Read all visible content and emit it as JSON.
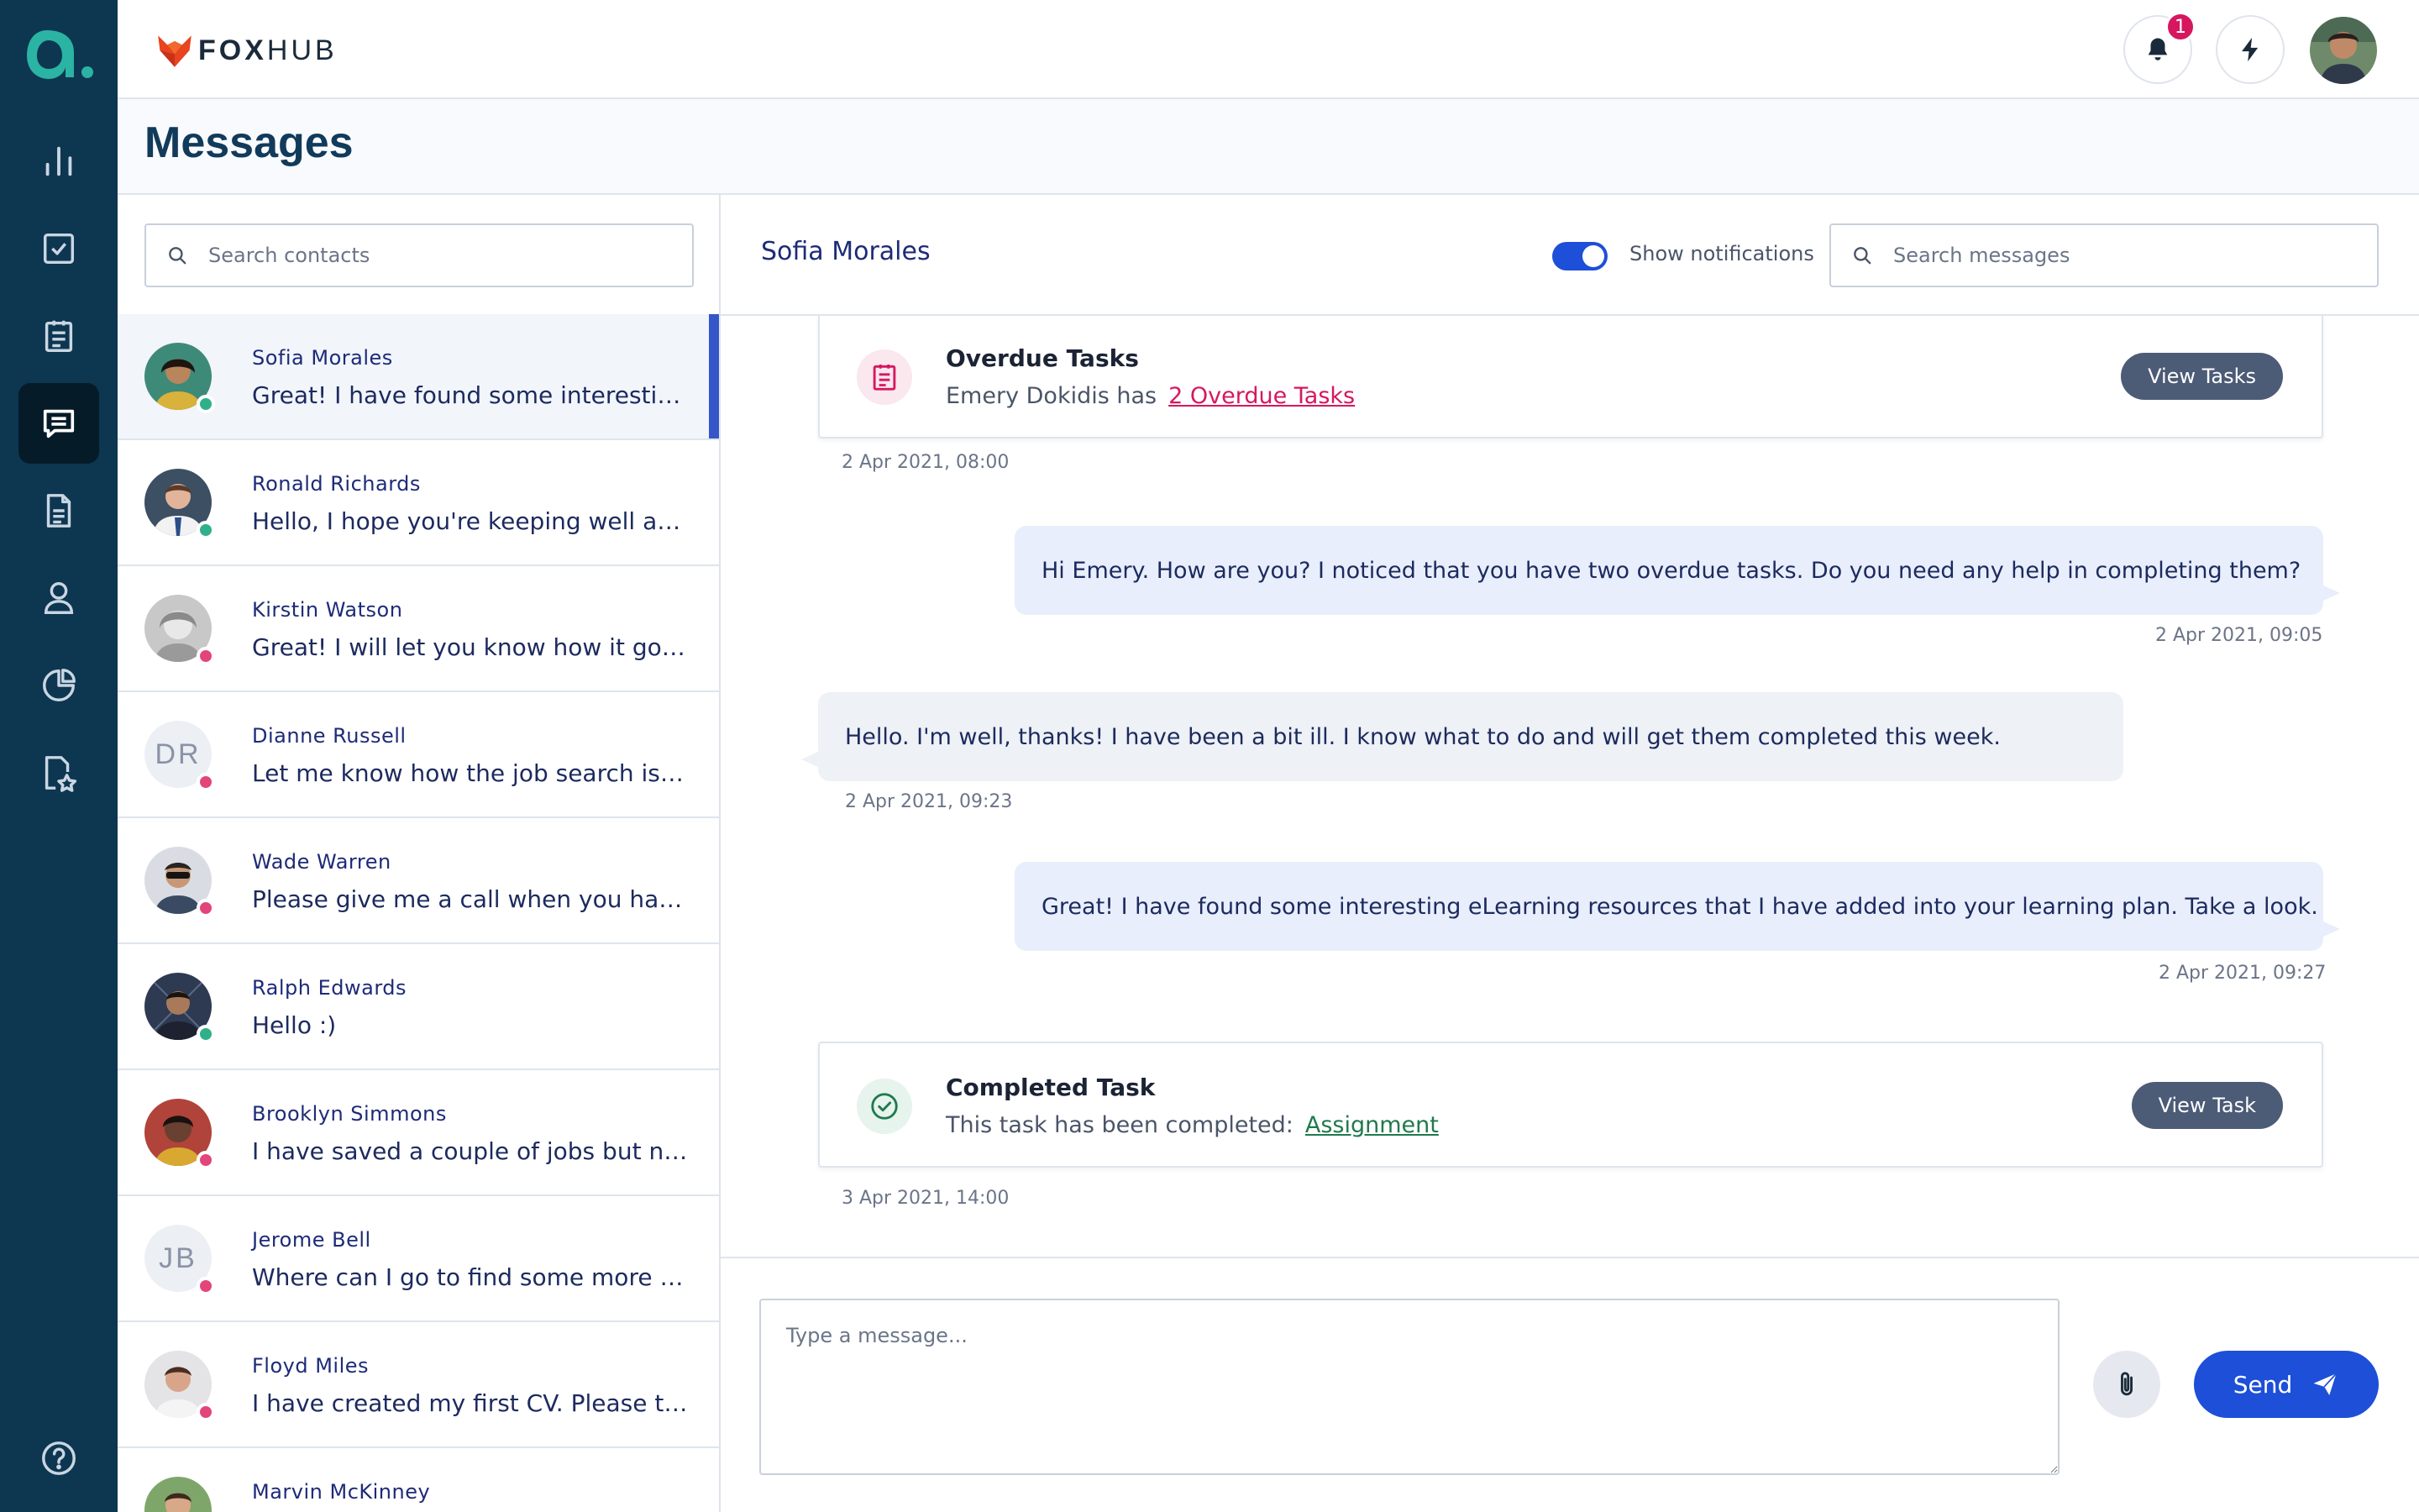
{
  "app": {
    "brand_bold": "FOX",
    "brand_light": "HUB",
    "notifications_count": "1"
  },
  "page": {
    "title": "Messages"
  },
  "colors": {
    "rail": "#0d3651",
    "accent": "#1d4fd8",
    "online": "#2fb08a",
    "offline": "#e3457a",
    "badge": "#d6175f"
  },
  "contacts": {
    "search_placeholder": "Search contacts",
    "items": [
      {
        "name": "Sofia Morales",
        "preview": "Great! I have found some interesting eLe...",
        "status": "online",
        "initials": "",
        "active": true
      },
      {
        "name": "Ronald Richards",
        "preview": "Hello, I hope you're keeping well and that...",
        "status": "online",
        "initials": ""
      },
      {
        "name": "Kirstin Watson",
        "preview": "Great! I will let you know how it goes late...",
        "status": "offline",
        "initials": ""
      },
      {
        "name": "Dianne Russell",
        "preview": "Let me know how the job search is going.",
        "status": "offline",
        "initials": "DR"
      },
      {
        "name": "Wade Warren",
        "preview": "Please give me a call when you have so...",
        "status": "offline",
        "initials": ""
      },
      {
        "name": "Ralph Edwards",
        "preview": "Hello :)",
        "status": "online",
        "initials": ""
      },
      {
        "name": "Brooklyn Simmons",
        "preview": "I have saved a couple of jobs but need so...",
        "status": "offline",
        "initials": ""
      },
      {
        "name": "Jerome Bell",
        "preview": "Where can I go to find some more info a...",
        "status": "offline",
        "initials": "JB"
      },
      {
        "name": "Floyd Miles",
        "preview": "I have created my first CV. Please take a...",
        "status": "offline",
        "initials": ""
      },
      {
        "name": "Marvin McKinney",
        "preview": "",
        "status": "online",
        "initials": ""
      }
    ]
  },
  "chat": {
    "contact_name": "Sofia Morales",
    "notifications_label": "Show notifications",
    "notifications_on": true,
    "search_placeholder": "Search messages",
    "overdue": {
      "title": "Overdue Tasks",
      "text": "Emery Dokidis has",
      "link": "2 Overdue Tasks",
      "button": "View Tasks",
      "time": "2 Apr 2021, 08:00"
    },
    "messages": [
      {
        "dir": "out",
        "text": "Hi Emery. How are you? I noticed that you have two overdue tasks. Do you need any help in completing them?",
        "time": "2 Apr 2021, 09:05"
      },
      {
        "dir": "in",
        "text": "Hello. I'm well, thanks! I have been a bit ill. I know what to do and will get them completed this week.",
        "time": "2 Apr 2021, 09:23"
      },
      {
        "dir": "out",
        "text": "Great! I have found some interesting eLearning resources that I have added into your learning plan. Take a look.",
        "time": "2 Apr 2021, 09:27"
      }
    ],
    "completed": {
      "title": "Completed Task",
      "text": "This task has been completed:",
      "link": "Assignment",
      "button": "View Task",
      "time": "3 Apr 2021, 14:00"
    },
    "composer": {
      "placeholder": "Type a message...",
      "send_label": "Send"
    }
  }
}
